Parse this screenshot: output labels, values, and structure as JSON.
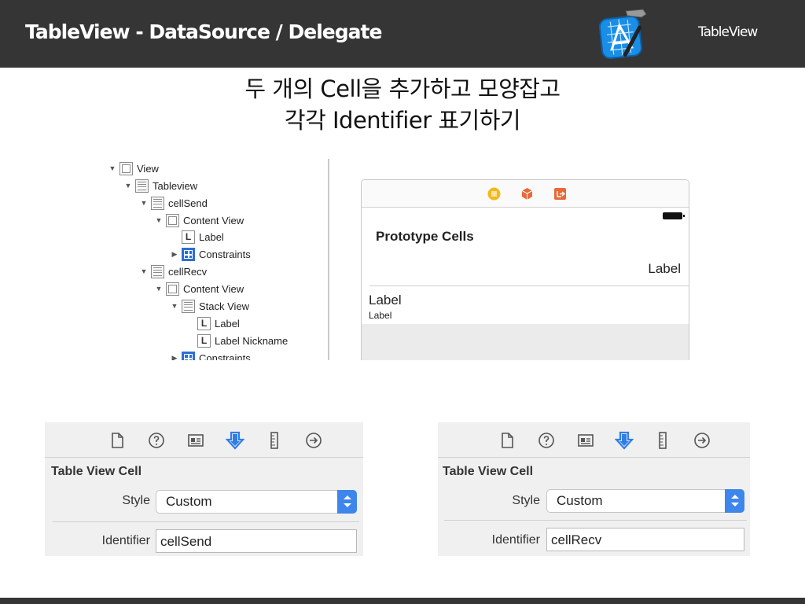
{
  "header": {
    "title": "TableView - DataSource / Delegate",
    "right_label": "TableView",
    "logo_icon": "xcode-icon",
    "background": "#353535"
  },
  "slide": {
    "title_line1": "두 개의 Cell을 추가하고 모양잡고",
    "title_line2": "각각 Identifier 표기하기"
  },
  "outline": {
    "items": [
      {
        "label": "View",
        "icon": "view-icon",
        "expanded": true
      },
      {
        "label": "Tableview",
        "icon": "tableview-icon",
        "expanded": true
      },
      {
        "label": "cellSend",
        "icon": "table-cell-icon",
        "expanded": true
      },
      {
        "label": "Content View",
        "icon": "view-icon",
        "expanded": true
      },
      {
        "label": "Label",
        "icon": "label-icon",
        "letter": "L"
      },
      {
        "label": "Constraints",
        "icon": "constraints-icon",
        "expanded": false
      },
      {
        "label": "cellRecv",
        "icon": "table-cell-icon",
        "expanded": true
      },
      {
        "label": "Content View",
        "icon": "view-icon",
        "expanded": true
      },
      {
        "label": "Stack View",
        "icon": "stack-view-icon",
        "expanded": true
      },
      {
        "label": "Label",
        "icon": "label-icon",
        "letter": "L"
      },
      {
        "label": "Label Nickname",
        "icon": "label-icon",
        "letter": "L"
      },
      {
        "label": "Constraints",
        "icon": "constraints-icon",
        "expanded": false
      }
    ]
  },
  "preview": {
    "toolbar_icons": [
      "view-controller-icon",
      "first-responder-icon",
      "exit-icon"
    ],
    "section_title": "Prototype Cells",
    "cell1_label": "Label",
    "cell2_title": "Label",
    "cell2_subtitle": "Label"
  },
  "inspector_tabs": [
    "file-inspector-icon",
    "quick-help-icon",
    "identity-inspector-icon",
    "attributes-inspector-icon",
    "size-inspector-icon",
    "connections-inspector-icon"
  ],
  "inspectors": [
    {
      "section_title": "Table View Cell",
      "style_label": "Style",
      "style_value": "Custom",
      "identifier_label": "Identifier",
      "identifier_value": "cellSend"
    },
    {
      "section_title": "Table View Cell",
      "style_label": "Style",
      "style_value": "Custom",
      "identifier_label": "Identifier",
      "identifier_value": "cellRecv"
    }
  ],
  "colors": {
    "accent_blue": "#3e85ec",
    "constraint_blue": "#2b6fd6",
    "icon_yellow": "#f5b81b",
    "icon_orange": "#e8693a"
  }
}
